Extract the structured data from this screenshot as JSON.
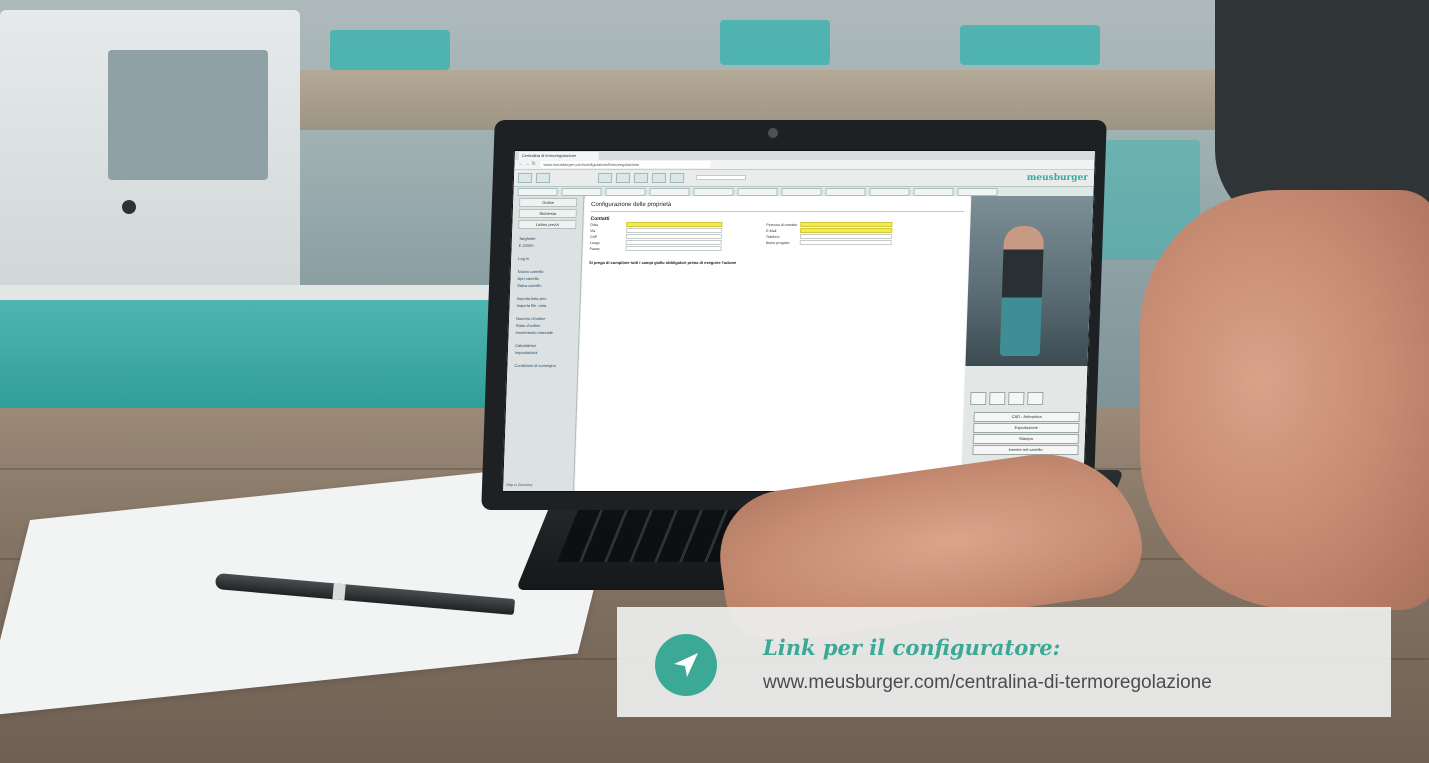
{
  "browser": {
    "tab_title": "Centralina di termoregolazione",
    "url": "www.meusburger.com/configuratore/termoregolazione"
  },
  "app": {
    "logo": "meusburger",
    "sidebar": {
      "tabs": [
        "Ordine",
        "Richiesta",
        "Listino prezzi"
      ],
      "items": [
        "Targhette",
        "E 20000",
        "Log in",
        "Nuovo carrello",
        "Apri carrello",
        "Salva carrello",
        "Importa lista pez.",
        "Importa file .mea",
        "Numero d'ordine",
        "Stato d'ordine",
        "Inserimento manuale",
        "Calcolatrice",
        "Impostazioni",
        "Condizioni di consegna"
      ],
      "footer": "Ship to Germany"
    },
    "main": {
      "title": "Configurazione delle proprietà",
      "section": "Contatti",
      "left_fields": [
        "Ditta",
        "Via",
        "CAP",
        "Luogo",
        "Paese"
      ],
      "right_fields": [
        "Persona di contatto",
        "E-Mail",
        "Telefono",
        "Nome progetto"
      ],
      "note": "Si prega di compilare tutti i campi giallo obbligatori prima di eseguire l'azione"
    },
    "right_pane": {
      "buttons": [
        "CAD - Anteprima",
        "Esportazione",
        "Stampa",
        "Inserire nel carrello"
      ]
    }
  },
  "caption": {
    "title": "Link per il configuratore:",
    "link": "www.meusburger.com/centralina-di-termoregolazione",
    "accent_color": "#3ba996",
    "icon": "send-arrow-icon"
  }
}
